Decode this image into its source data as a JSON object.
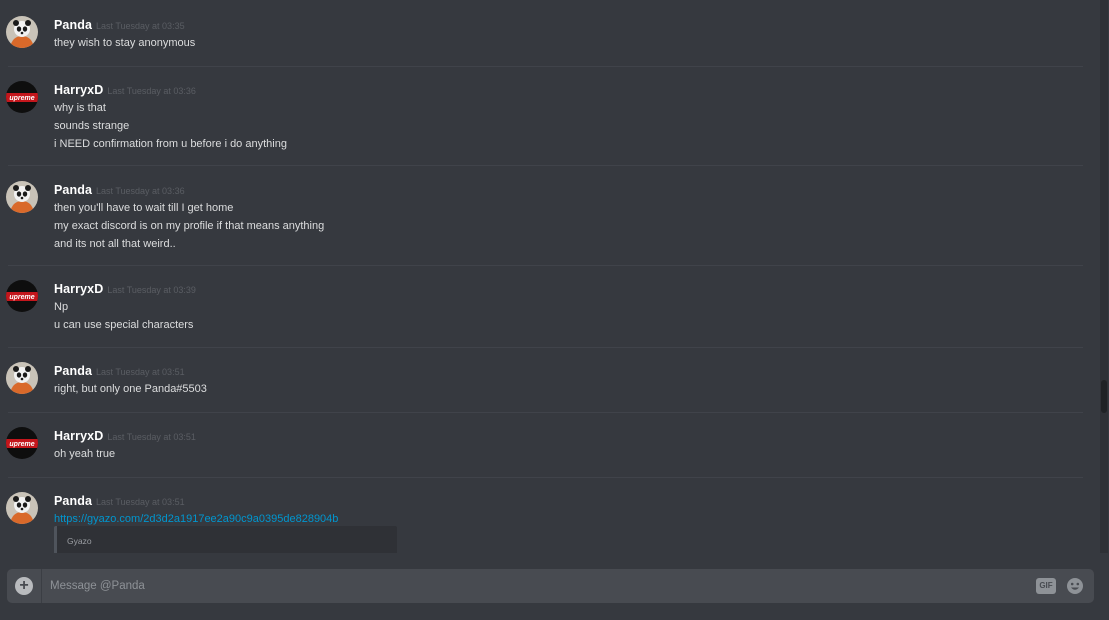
{
  "messages": [
    {
      "author": "Panda",
      "avatar": "panda-avatar",
      "timestamp": "Last Tuesday at 03:35",
      "lines": [
        "they wish to stay anonymous"
      ]
    },
    {
      "author": "HarryxD",
      "avatar": "supreme-avatar",
      "timestamp": "Last Tuesday at 03:36",
      "lines": [
        "why is that",
        "sounds strange",
        "i NEED confirmation from u before i do anything"
      ]
    },
    {
      "author": "Panda",
      "avatar": "panda-avatar",
      "timestamp": "Last Tuesday at 03:36",
      "lines": [
        "then you'll have to wait till I get home",
        "my exact discord is on my profile if that means anything",
        "and its not all that weird.."
      ]
    },
    {
      "author": "HarryxD",
      "avatar": "supreme-avatar",
      "timestamp": "Last Tuesday at 03:39",
      "lines": [
        "Np",
        "u can use special characters"
      ]
    },
    {
      "author": "Panda",
      "avatar": "panda-avatar",
      "timestamp": "Last Tuesday at 03:51",
      "lines": [
        "right, but only one Panda#5503"
      ]
    },
    {
      "author": "HarryxD",
      "avatar": "supreme-avatar",
      "timestamp": "Last Tuesday at 03:51",
      "lines": [
        "oh yeah true"
      ]
    },
    {
      "author": "Panda",
      "avatar": "panda-avatar",
      "timestamp": "Last Tuesday at 03:51",
      "link": "https://gyazo.com/2d3d2a1917ee2a90c9a0395de828904b",
      "embed_provider": "Gyazo"
    }
  ],
  "avatar_text": {
    "supreme": "upreme"
  },
  "composer": {
    "placeholder": "Message @Panda",
    "gif_label": "GIF",
    "add_icon": "plus-circle-icon",
    "emoji_icon": "smiley-icon"
  },
  "colors": {
    "background": "#36393f",
    "username": "#ffffff",
    "message_text": "#dcddde",
    "timestamp": "#5a5d63",
    "link": "#0096cf",
    "composer": "#484b51"
  }
}
